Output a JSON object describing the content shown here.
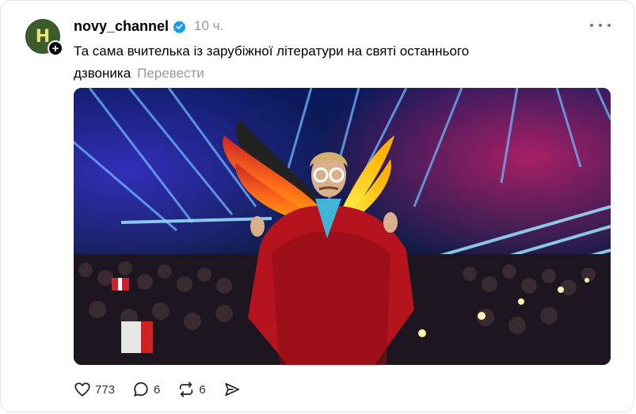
{
  "post": {
    "avatar_letter": "H",
    "follow_badge": "+",
    "username": "novy_channel",
    "verified": true,
    "timestamp": "10 ч.",
    "text": "Та сама вчителька із зарубіжної літератури на святі останнього дзвоника",
    "translate_label": "Перевести",
    "media": {
      "description_icon": "video-frame"
    },
    "actions": {
      "likes": "773",
      "replies": "6",
      "reposts": "6"
    },
    "colors": {
      "accent_verified": "#1d9bf0",
      "secondary_text": "#999999"
    }
  }
}
